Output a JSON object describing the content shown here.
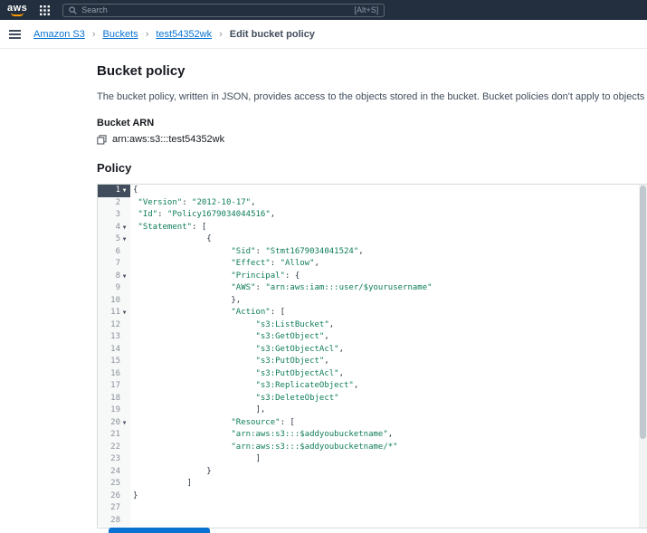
{
  "topbar": {
    "logo_text": "aws",
    "search": {
      "placeholder": "Search",
      "shortcut": "[Alt+S]"
    }
  },
  "breadcrumb": {
    "separator": "›",
    "items": [
      {
        "label": "Amazon S3"
      },
      {
        "label": "Buckets"
      },
      {
        "label": "test54352wk"
      },
      {
        "label": "Edit bucket policy"
      }
    ]
  },
  "main": {
    "title": "Bucket policy",
    "description": "The bucket policy, written in JSON, provides access to the objects stored in the bucket. Bucket policies don't apply to objects owned by other accounts.",
    "bucket_arn_label": "Bucket ARN",
    "bucket_arn": "arn:aws:s3:::test54352wk",
    "policy_label": "Policy"
  },
  "editor": {
    "lines": [
      {
        "n": "1",
        "fold": true,
        "active": true,
        "code": "{"
      },
      {
        "n": "2",
        "fold": false,
        "active": false,
        "code": " \"Version\": \"2012-10-17\","
      },
      {
        "n": "3",
        "fold": false,
        "active": false,
        "code": " \"Id\": \"Policy1679034044516\","
      },
      {
        "n": "4",
        "fold": true,
        "active": false,
        "code": " \"Statement\": ["
      },
      {
        "n": "5",
        "fold": true,
        "active": false,
        "code": "               {"
      },
      {
        "n": "6",
        "fold": false,
        "active": false,
        "code": "                    \"Sid\": \"Stmt1679034041524\","
      },
      {
        "n": "7",
        "fold": false,
        "active": false,
        "code": "                    \"Effect\": \"Allow\","
      },
      {
        "n": "8",
        "fold": true,
        "active": false,
        "code": "                    \"Principal\": {"
      },
      {
        "n": "9",
        "fold": false,
        "active": false,
        "code": "                    \"AWS\": \"arn:aws:iam:::user/$yourusername\""
      },
      {
        "n": "10",
        "fold": false,
        "active": false,
        "code": "                    },"
      },
      {
        "n": "11",
        "fold": true,
        "active": false,
        "code": "                    \"Action\": ["
      },
      {
        "n": "12",
        "fold": false,
        "active": false,
        "code": "                         \"s3:ListBucket\","
      },
      {
        "n": "13",
        "fold": false,
        "active": false,
        "code": "                         \"s3:GetObject\","
      },
      {
        "n": "14",
        "fold": false,
        "active": false,
        "code": "                         \"s3:GetObjectAcl\","
      },
      {
        "n": "15",
        "fold": false,
        "active": false,
        "code": "                         \"s3:PutObject\","
      },
      {
        "n": "16",
        "fold": false,
        "active": false,
        "code": "                         \"s3:PutObjectAcl\","
      },
      {
        "n": "17",
        "fold": false,
        "active": false,
        "code": "                         \"s3:ReplicateObject\","
      },
      {
        "n": "18",
        "fold": false,
        "active": false,
        "code": "                         \"s3:DeleteObject\""
      },
      {
        "n": "19",
        "fold": false,
        "active": false,
        "code": "                         ],"
      },
      {
        "n": "20",
        "fold": true,
        "active": false,
        "code": "                    \"Resource\": ["
      },
      {
        "n": "21",
        "fold": false,
        "active": false,
        "code": "                    \"arn:aws:s3:::$addyoubucketname\","
      },
      {
        "n": "22",
        "fold": false,
        "active": false,
        "code": "                    \"arn:aws:s3:::$addyoubucketname/*\""
      },
      {
        "n": "23",
        "fold": false,
        "active": false,
        "code": "                         ]"
      },
      {
        "n": "24",
        "fold": false,
        "active": false,
        "code": "               }"
      },
      {
        "n": "25",
        "fold": false,
        "active": false,
        "code": "           ]"
      },
      {
        "n": "26",
        "fold": false,
        "active": false,
        "code": "}"
      },
      {
        "n": "27",
        "fold": false,
        "active": false,
        "code": ""
      },
      {
        "n": "28",
        "fold": false,
        "active": false,
        "code": ""
      }
    ]
  },
  "colors": {
    "accent": "#0972d3",
    "topbar": "#232f3e",
    "link": "#0972d3",
    "code_string": "#0e7c5b",
    "active_line": "#414d5c",
    "aws_orange": "#ff9900"
  }
}
